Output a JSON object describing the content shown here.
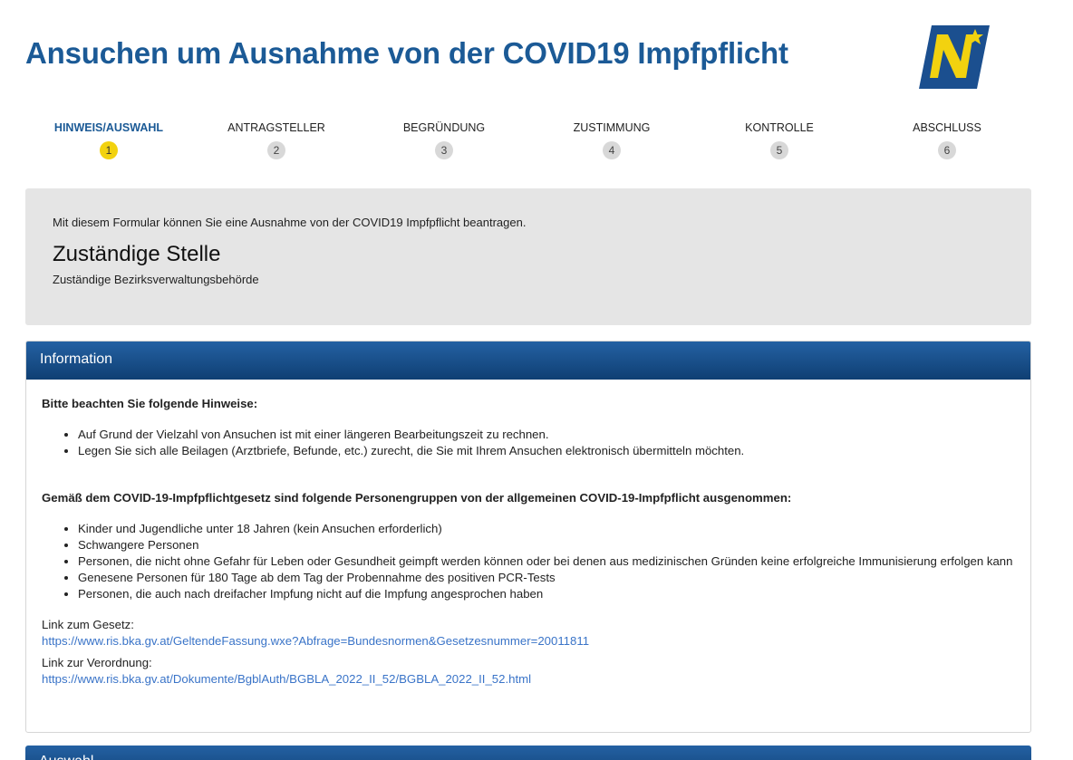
{
  "header": {
    "title": "Ansuchen um Ausnahme von der COVID19 Impfpflicht",
    "logo_name": "noe-logo"
  },
  "steps": [
    {
      "label": "HINWEIS/AUSWAHL",
      "number": "1",
      "active": true
    },
    {
      "label": "ANTRAGSTELLER",
      "number": "2",
      "active": false
    },
    {
      "label": "BEGRÜNDUNG",
      "number": "3",
      "active": false
    },
    {
      "label": "ZUSTIMMUNG",
      "number": "4",
      "active": false
    },
    {
      "label": "KONTROLLE",
      "number": "5",
      "active": false
    },
    {
      "label": "ABSCHLUSS",
      "number": "6",
      "active": false
    }
  ],
  "intro": {
    "text": "Mit diesem Formular können Sie eine Ausnahme von der COVID19 Impfpflicht beantragen.",
    "heading": "Zuständige Stelle",
    "sub": "Zuständige Bezirksverwaltungsbehörde"
  },
  "info_panel": {
    "title": "Information",
    "notes_heading": "Bitte beachten Sie folgende Hinweise:",
    "notes": [
      "Auf Grund der Vielzahl von Ansuchen ist mit einer längeren Bearbeitungszeit zu rechnen.",
      "Legen Sie sich alle Beilagen (Arztbriefe, Befunde, etc.) zurecht, die Sie mit Ihrem Ansuchen elektronisch übermitteln möchten."
    ],
    "groups_heading": "Gemäß dem COVID-19-Impfpflichtgesetz sind folgende Personengruppen von der allgemeinen COVID-19-Impfpflicht ausgenommen:",
    "groups": [
      "Kinder und Jugendliche unter 18 Jahren (kein Ansuchen erforderlich)",
      "Schwangere Personen",
      "Personen, die nicht ohne Gefahr für Leben oder Gesundheit geimpft werden können oder bei denen aus medizinischen Gründen keine erfolgreiche Immunisierung erfolgen kann",
      "Genesene Personen für 180 Tage ab dem Tag der Probennahme des positiven PCR-Tests",
      "Personen, die auch nach dreifacher Impfung nicht auf die Impfung angesprochen haben"
    ],
    "law_link_label": "Link zum Gesetz:",
    "law_link": "https://www.ris.bka.gv.at/GeltendeFassung.wxe?Abfrage=Bundesnormen&Gesetzesnummer=20011811",
    "decree_link_label": "Link zur Verordnung:",
    "decree_link": "https://www.ris.bka.gv.at/Dokumente/BgblAuth/BGBLA_2022_II_52/BGBLA_2022_II_52.html"
  },
  "next_panel": {
    "title": "Auswahl"
  },
  "colors": {
    "brand_blue": "#1b5a96",
    "active_step": "#f2d20f",
    "link": "#3a74c8"
  }
}
